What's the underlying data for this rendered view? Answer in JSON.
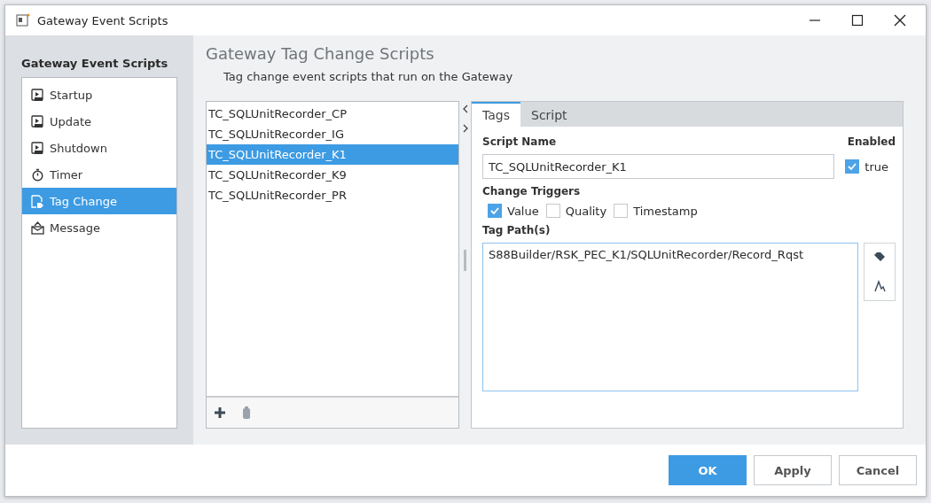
{
  "window": {
    "title": "Gateway Event Scripts"
  },
  "sidebar": {
    "heading": "Gateway Event Scripts",
    "items": [
      {
        "label": "Startup",
        "kind": "script",
        "selected": false
      },
      {
        "label": "Update",
        "kind": "script",
        "selected": false
      },
      {
        "label": "Shutdown",
        "kind": "script",
        "selected": false
      },
      {
        "label": "Timer",
        "kind": "timer",
        "selected": false
      },
      {
        "label": "Tag Change",
        "kind": "tag",
        "selected": true
      },
      {
        "label": "Message",
        "kind": "message",
        "selected": false
      }
    ]
  },
  "page": {
    "title": "Gateway Tag Change Scripts",
    "subtitle": "Tag change event scripts that run on the Gateway"
  },
  "scripts": [
    {
      "name": "TC_SQLUnitRecorder_CP",
      "selected": false
    },
    {
      "name": "TC_SQLUnitRecorder_IG",
      "selected": false
    },
    {
      "name": "TC_SQLUnitRecorder_K1",
      "selected": true
    },
    {
      "name": "TC_SQLUnitRecorder_K9",
      "selected": false
    },
    {
      "name": "TC_SQLUnitRecorder_PR",
      "selected": false
    }
  ],
  "tabs": [
    {
      "label": "Tags",
      "selected": true
    },
    {
      "label": "Script",
      "selected": false
    }
  ],
  "form": {
    "script_name_label": "Script Name",
    "script_name": "TC_SQLUnitRecorder_K1",
    "enabled_label": "Enabled",
    "enabled": {
      "label": "true",
      "checked": true
    },
    "triggers_label": "Change Triggers",
    "triggers": [
      {
        "label": "Value",
        "checked": true
      },
      {
        "label": "Quality",
        "checked": false
      },
      {
        "label": "Timestamp",
        "checked": false
      }
    ],
    "tag_paths_label": "Tag Path(s)",
    "tag_paths": "S88Builder/RSK_PEC_K1/SQLUnitRecorder/Record_Rqst"
  },
  "buttons": [
    {
      "label": "OK",
      "kind": "primary"
    },
    {
      "label": "Apply",
      "kind": "normal"
    },
    {
      "label": "Cancel",
      "kind": "normal"
    }
  ]
}
